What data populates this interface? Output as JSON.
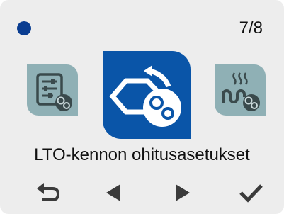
{
  "status": {
    "indicator_color": "#0a3d91"
  },
  "pager": {
    "counter": "7/8"
  },
  "carousel": {
    "previous_item_icon": "settings-sliders-gear-icon",
    "selected_item_icon": "heat-exchanger-bypass-gear-icon",
    "next_item_icon": "heating-coil-gear-icon",
    "selected_color": "#0a55a8",
    "inactive_color": "#8fb0b5"
  },
  "menu": {
    "title": "LTO-kennon ohitusasetukset"
  },
  "navigation": {
    "back_icon": "back-arrow-icon",
    "previous_icon": "left-triangle-icon",
    "next_icon": "right-triangle-icon",
    "confirm_icon": "checkmark-icon"
  }
}
